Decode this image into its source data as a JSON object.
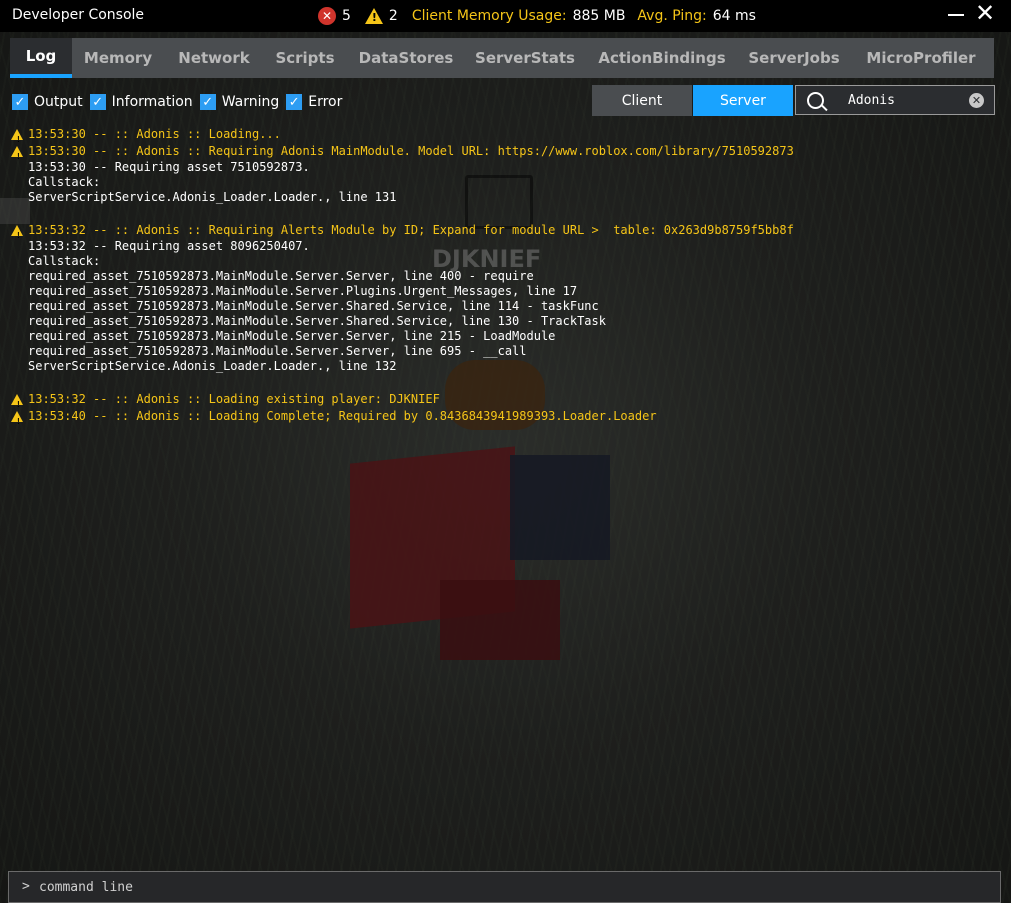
{
  "window": {
    "title": "Developer Console",
    "error_count": "5",
    "warning_count": "2",
    "memory_label": "Client Memory Usage:",
    "memory_value": "885 MB",
    "ping_label": "Avg. Ping:",
    "ping_value": "64 ms"
  },
  "tabs": [
    {
      "label": "Log",
      "active": true
    },
    {
      "label": "Memory",
      "active": false
    },
    {
      "label": "Network",
      "active": false
    },
    {
      "label": "Scripts",
      "active": false
    },
    {
      "label": "DataStores",
      "active": false
    },
    {
      "label": "ServerStats",
      "active": false
    },
    {
      "label": "ActionBindings",
      "active": false
    },
    {
      "label": "ServerJobs",
      "active": false
    },
    {
      "label": "MicroProfiler",
      "active": false
    }
  ],
  "filters": {
    "output": {
      "label": "Output",
      "checked": true
    },
    "information": {
      "label": "Information",
      "checked": true
    },
    "warning": {
      "label": "Warning",
      "checked": true
    },
    "error": {
      "label": "Error",
      "checked": true
    }
  },
  "toggle": {
    "client": "Client",
    "server": "Server",
    "selected": "Server"
  },
  "search": {
    "value": "Adonis"
  },
  "scene": {
    "nametag": "DJKNIEF"
  },
  "log": {
    "entry1": {
      "warn1": "13:53:30 -- :: Adonis :: Loading...",
      "warn2": "13:53:30 -- :: Adonis :: Requiring Adonis MainModule. Model URL: https://www.roblox.com/library/7510592873",
      "info1": "13:53:30 -- Requiring asset 7510592873.",
      "info2": "Callstack:",
      "info3": "ServerScriptService.Adonis_Loader.Loader., line 131"
    },
    "entry2": {
      "warn1": "13:53:32 -- :: Adonis :: Requiring Alerts Module by ID; Expand for module URL >  table: 0x263d9b8759f5bb8f",
      "info1": "13:53:32 -- Requiring asset 8096250407.",
      "info2": "Callstack:",
      "info3": "required_asset_7510592873.MainModule.Server.Server, line 400 - require",
      "info4": "required_asset_7510592873.MainModule.Server.Plugins.Urgent_Messages, line 17",
      "info5": "required_asset_7510592873.MainModule.Server.Shared.Service, line 114 - taskFunc",
      "info6": "required_asset_7510592873.MainModule.Server.Shared.Service, line 130 - TrackTask",
      "info7": "required_asset_7510592873.MainModule.Server.Server, line 215 - LoadModule",
      "info8": "required_asset_7510592873.MainModule.Server.Server, line 695 - __call",
      "info9": "ServerScriptService.Adonis_Loader.Loader., line 132"
    },
    "entry3": {
      "warn1": "13:53:32 -- :: Adonis :: Loading existing player: DJKNIEF",
      "warn2": "13:53:40 -- :: Adonis :: Loading Complete; Required by 0.8436843941989393.Loader.Loader"
    }
  },
  "command": {
    "prompt": ">",
    "placeholder": "command line"
  },
  "colors": {
    "accent": "#19a3ff",
    "warning": "#f5c518",
    "error": "#d0342c",
    "tab_bar": "#4a4d50"
  }
}
